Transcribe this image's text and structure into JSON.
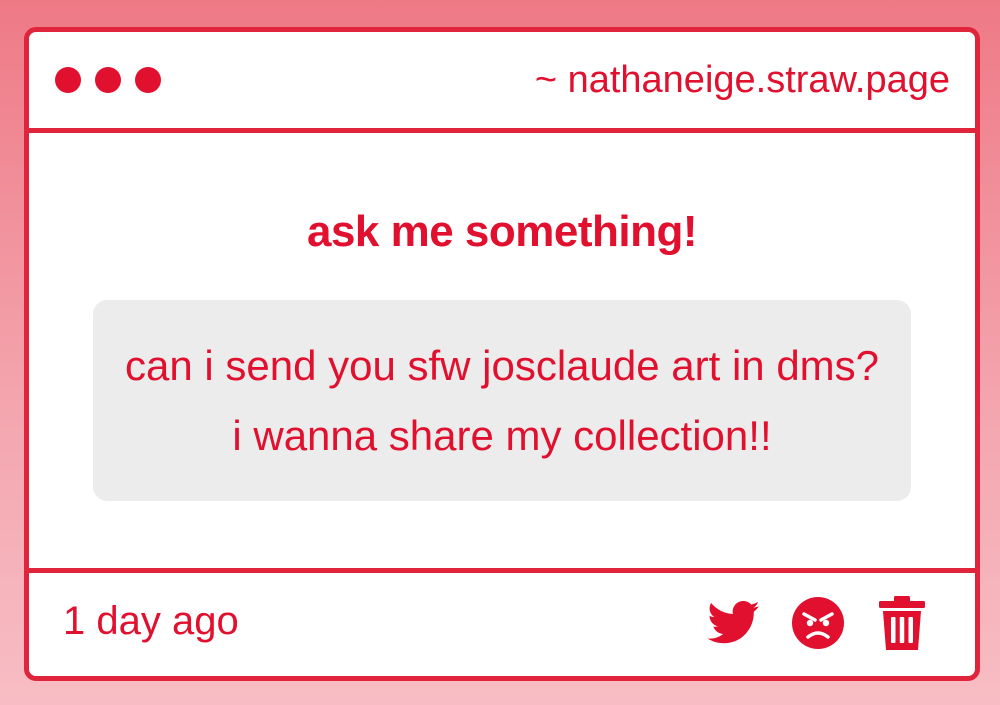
{
  "window": {
    "url": "~ nathaneige.straw.page"
  },
  "main": {
    "prompt": "ask me something!",
    "question": "can i send you sfw josclaude art in dms? i wanna share my collection!!"
  },
  "footer": {
    "timestamp": "1 day ago",
    "actions": [
      "twitter-icon",
      "angry-face-icon",
      "trash-icon"
    ]
  },
  "colors": {
    "accent": "#e0102e",
    "border": "#e0243b",
    "question_bg": "#ececec",
    "background_top": "#ee7a86",
    "background_bottom": "#f8bdc4"
  }
}
